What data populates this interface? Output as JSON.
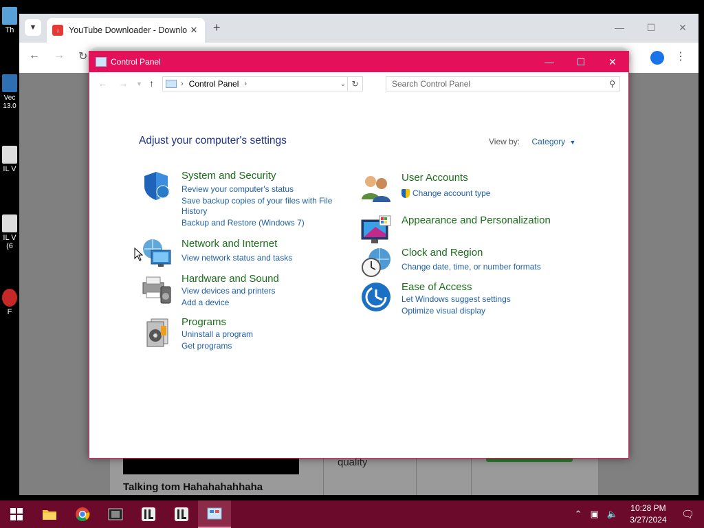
{
  "desktop": {
    "icons": [
      {
        "label": "Th"
      },
      {
        "label": "Vec 13.0"
      },
      {
        "label": "IL V"
      },
      {
        "label": "IL V (6"
      },
      {
        "label": "F"
      }
    ]
  },
  "browser": {
    "tab_title": "YouTube Downloader - Downlo",
    "content": {
      "video_caption": "Talking tom Hahahahahhaha",
      "quality_label": "quality"
    }
  },
  "control_panel": {
    "window_title": "Control Panel",
    "breadcrumb": "Control Panel",
    "search_placeholder": "Search Control Panel",
    "heading": "Adjust your computer's settings",
    "view_by_label": "View by:",
    "view_by_value": "Category",
    "categories_left": [
      {
        "title": "System and Security",
        "icon": "shield-icon",
        "links": [
          "Review your computer's status",
          "Save backup copies of your files with File",
          "History",
          "Backup and Restore (Windows 7)"
        ]
      },
      {
        "title": "Network and Internet",
        "icon": "network-globe-icon",
        "links": [
          "View network status and tasks"
        ]
      },
      {
        "title": "Hardware and Sound",
        "icon": "printer-speaker-icon",
        "links": [
          "View devices and printers",
          "Add a device"
        ]
      },
      {
        "title": "Programs",
        "icon": "programs-disc-icon",
        "links": [
          "Uninstall a program",
          "Get programs"
        ]
      }
    ],
    "categories_right": [
      {
        "title": "User Accounts",
        "icon": "users-icon",
        "links": [
          "Change account type"
        ]
      },
      {
        "title": "Appearance and Personalization",
        "icon": "monitor-palette-icon",
        "links": []
      },
      {
        "title": "Clock and Region",
        "icon": "clock-globe-icon",
        "links": [
          "Change date, time, or number formats"
        ]
      },
      {
        "title": "Ease of Access",
        "icon": "ease-of-access-icon",
        "links": [
          "Let Windows suggest settings",
          "Optimize visual display"
        ]
      }
    ]
  },
  "taskbar": {
    "time": "10:28 PM",
    "date": "3/27/2024"
  },
  "colors": {
    "titlebar": "#e5105a",
    "taskbar": "#6b0a2a",
    "link": "#1f5fa8",
    "category_title": "#1a6e1a",
    "heading": "#1e3287"
  }
}
